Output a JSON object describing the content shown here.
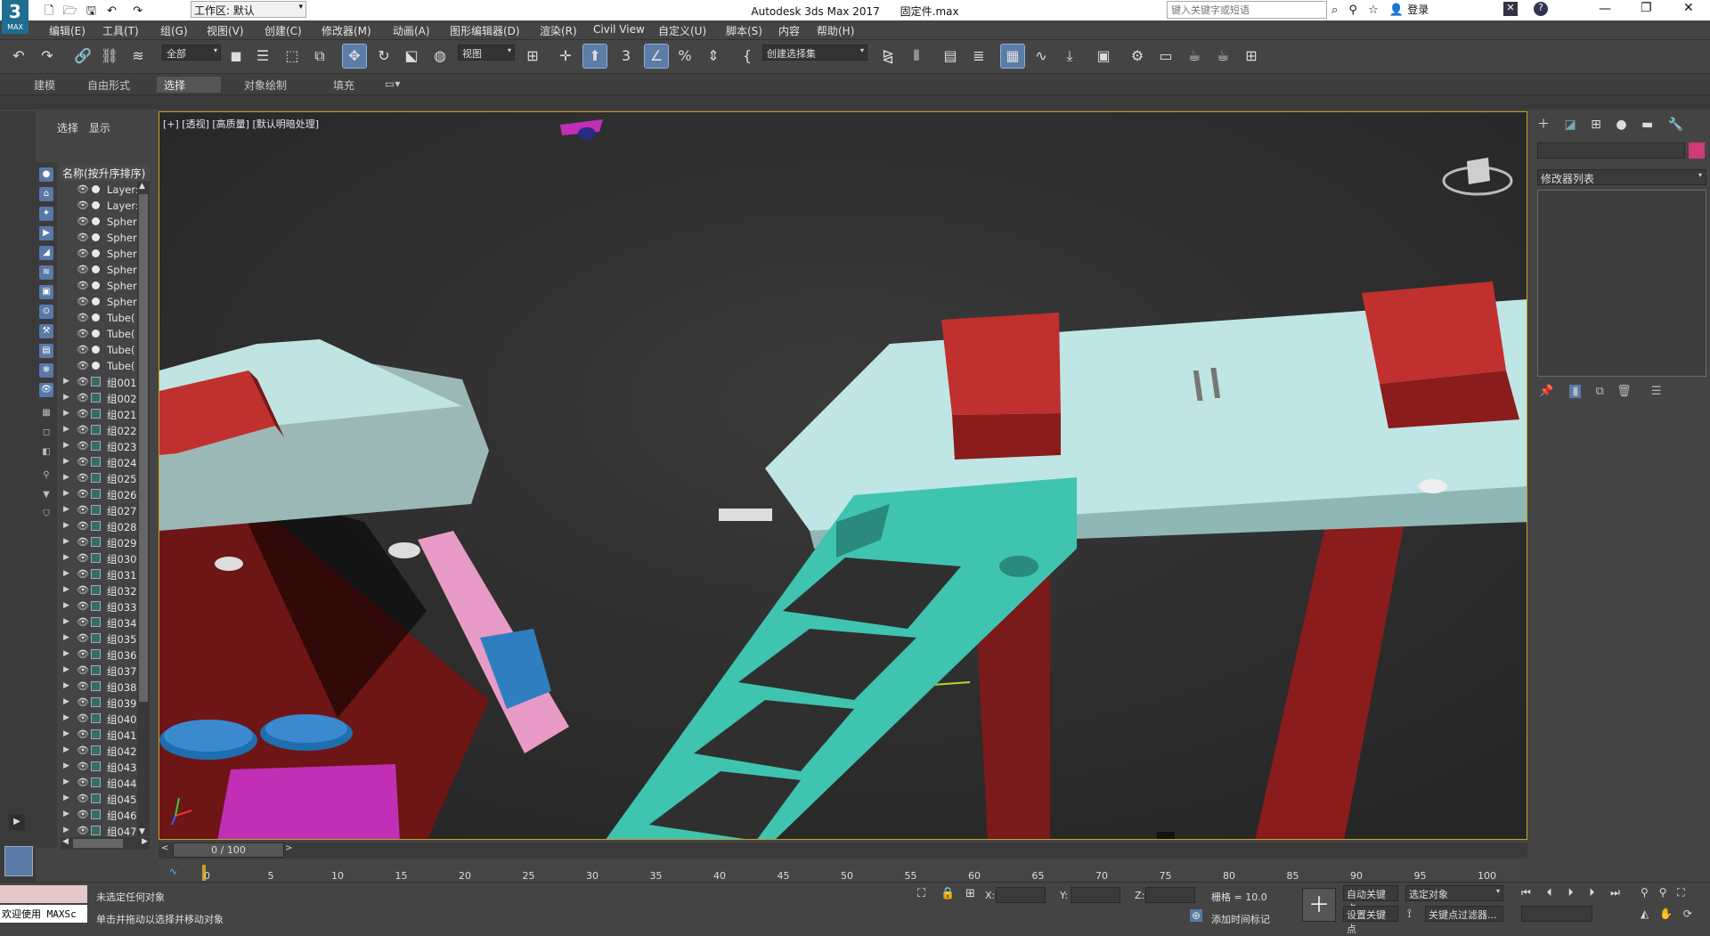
{
  "app": {
    "logo_text": "MAX",
    "title": "Autodesk 3ds Max 2017      固定件.max",
    "workspace": "工作区: 默认",
    "search_placeholder": "键入关键字或短语",
    "login": "登录"
  },
  "menu": [
    "编辑(E)",
    "工具(T)",
    "组(G)",
    "视图(V)",
    "创建(C)",
    "修改器(M)",
    "动画(A)",
    "图形编辑器(D)",
    "渲染(R)",
    "Civil View",
    "自定义(U)",
    "脚本(S)",
    "内容",
    "帮助(H)"
  ],
  "toolbar": {
    "filter_dropdown": "全部",
    "coord_dropdown": "视图",
    "selection_set": "创建选择集"
  },
  "ribbon_tabs": [
    "建模",
    "自由形式",
    "选择",
    "对象绘制",
    "填充"
  ],
  "scene_explorer": {
    "tabs": [
      "选择",
      "显示"
    ],
    "column_header": "名称(按升序排序)",
    "items": [
      {
        "name": "Layer:",
        "type": "obj"
      },
      {
        "name": "Layer:",
        "type": "obj"
      },
      {
        "name": "Spher",
        "type": "obj"
      },
      {
        "name": "Spher",
        "type": "obj"
      },
      {
        "name": "Spher",
        "type": "obj"
      },
      {
        "name": "Spher",
        "type": "obj"
      },
      {
        "name": "Spher",
        "type": "obj"
      },
      {
        "name": "Spher",
        "type": "obj"
      },
      {
        "name": "Tube(",
        "type": "obj"
      },
      {
        "name": "Tube(",
        "type": "obj"
      },
      {
        "name": "Tube(",
        "type": "obj"
      },
      {
        "name": "Tube(",
        "type": "obj"
      },
      {
        "name": "组001",
        "type": "group"
      },
      {
        "name": "组002",
        "type": "group"
      },
      {
        "name": "组021",
        "type": "group"
      },
      {
        "name": "组022",
        "type": "group"
      },
      {
        "name": "组023",
        "type": "group"
      },
      {
        "name": "组024",
        "type": "group"
      },
      {
        "name": "组025",
        "type": "group"
      },
      {
        "name": "组026",
        "type": "group"
      },
      {
        "name": "组027",
        "type": "group"
      },
      {
        "name": "组028",
        "type": "group"
      },
      {
        "name": "组029",
        "type": "group"
      },
      {
        "name": "组030",
        "type": "group"
      },
      {
        "name": "组031",
        "type": "group"
      },
      {
        "name": "组032",
        "type": "group"
      },
      {
        "name": "组033",
        "type": "group"
      },
      {
        "name": "组034",
        "type": "group"
      },
      {
        "name": "组035",
        "type": "group"
      },
      {
        "name": "组036",
        "type": "group"
      },
      {
        "name": "组037",
        "type": "group"
      },
      {
        "name": "组038",
        "type": "group"
      },
      {
        "name": "组039",
        "type": "group"
      },
      {
        "name": "组040",
        "type": "group"
      },
      {
        "name": "组041",
        "type": "group"
      },
      {
        "name": "组042",
        "type": "group"
      },
      {
        "name": "组043",
        "type": "group"
      },
      {
        "name": "组044",
        "type": "group"
      },
      {
        "name": "组045",
        "type": "group"
      },
      {
        "name": "组046",
        "type": "group"
      },
      {
        "name": "组047",
        "type": "group"
      }
    ]
  },
  "viewport": {
    "label": "[+] [透视] [高质量] [默认明暗处理]",
    "border_color": "#c9a227"
  },
  "command_panel": {
    "modifier_list": "修改器列表",
    "object_color": "#d03a7a"
  },
  "timeline": {
    "frame_display": "0 / 100",
    "ticks": [
      "0",
      "5",
      "10",
      "15",
      "20",
      "25",
      "30",
      "35",
      "40",
      "45",
      "50",
      "55",
      "60",
      "65",
      "70",
      "75",
      "80",
      "85",
      "90",
      "95",
      "100"
    ]
  },
  "status": {
    "maxscript": "欢迎使用 MAXSc",
    "selection": "未选定任何对象",
    "prompt": "单击并拖动以选择并移动对象",
    "x_label": "X:",
    "y_label": "Y:",
    "z_label": "Z:",
    "grid": "栅格 = 10.0",
    "add_time_tag": "添加时间标记",
    "auto_key": "自动关键点",
    "set_key": "设置关键点",
    "selected_object": "选定对象",
    "key_filters": "关键点过滤器..."
  },
  "colors": {
    "accent": "#5b7da8",
    "bracket": "#3fc4b0",
    "plate": "#bde8e6",
    "red_block": "#c0302e"
  }
}
